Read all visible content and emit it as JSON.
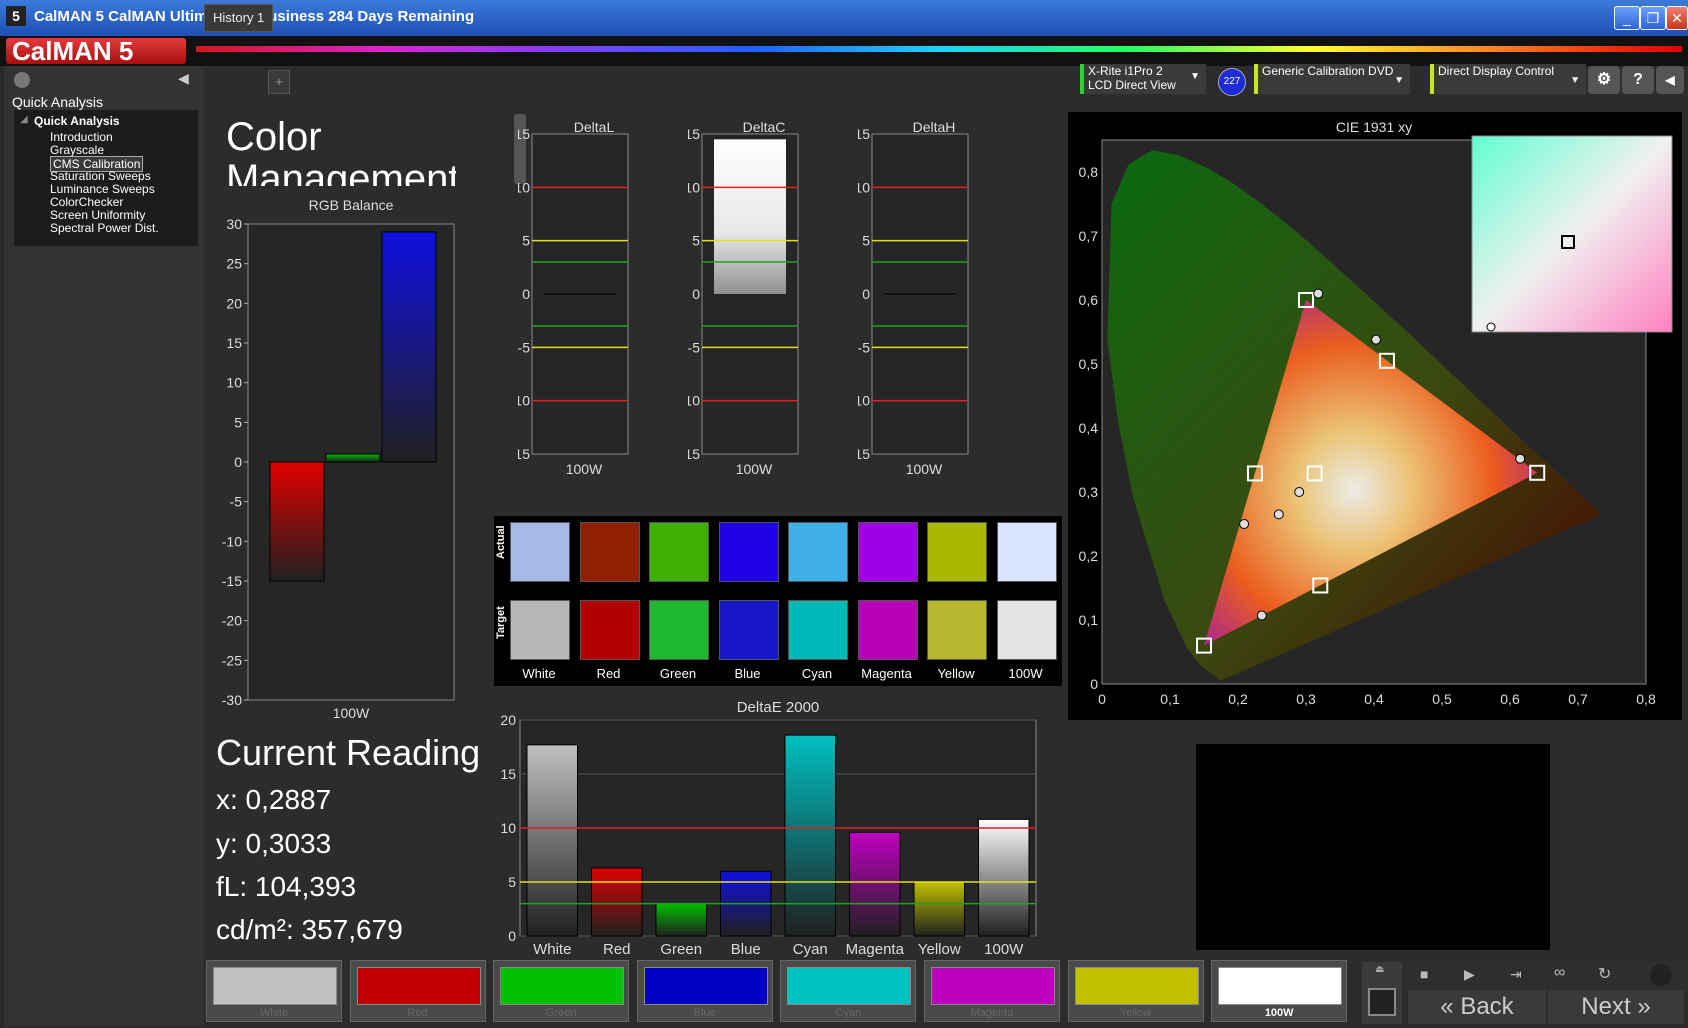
{
  "window": {
    "title": "CalMAN 5 CalMAN Ultimate for Business 284 Days Remaining",
    "app_icon": "5",
    "minimize": "_",
    "restore": "❐",
    "close": "✕"
  },
  "logo": "CalMAN 5",
  "sidebar": {
    "section_label": "Quick Analysis",
    "tree_root": "Quick Analysis",
    "items": [
      "Introduction",
      "Grayscale",
      "CMS Calibration",
      "Saturation Sweeps",
      "Luminance Sweeps",
      "ColorChecker",
      "Screen Uniformity",
      "Spectral Power Dist."
    ],
    "selected_index": 2
  },
  "tabs": {
    "active": "History 1",
    "add": "+"
  },
  "devices": {
    "meter_line1": "X-Rite i1Pro 2",
    "meter_line2": "LCD Direct View",
    "meter_badge": "227",
    "source": "Generic Calibration DVD",
    "display": "Direct Display Control",
    "settings_icon": "⚙",
    "help_icon": "?",
    "collapse_icon": "◀"
  },
  "page": {
    "title_line1": "Color",
    "title_line2": "Management"
  },
  "reading": {
    "heading": "Current Reading",
    "x": "x: 0,2887",
    "y": "y: 0,3033",
    "fl": "fL: 104,393",
    "cdm2": "cd/m²: 357,679"
  },
  "colors": {
    "red": "#e00000",
    "green": "#00c000",
    "blue": "#1010e0",
    "cyan": "#00c0c0",
    "magenta": "#c000c0",
    "yellow": "#c0c000",
    "white": "#ffffff",
    "gray": "#c0c0c0"
  },
  "rgb_chart": {
    "type": "bar",
    "title": "RGB Balance",
    "categories": [
      "100W"
    ],
    "series": [
      {
        "values": [
          -15
        ]
      },
      {
        "values": [
          1
        ]
      },
      {
        "values": [
          29
        ]
      }
    ],
    "ylim": [
      -30,
      30
    ],
    "yticks": [
      "30",
      "25",
      "20",
      "15",
      "10",
      "5",
      "0",
      "-5",
      "-10",
      "-15",
      "-20",
      "-25",
      "-30"
    ]
  },
  "delta_charts": [
    {
      "type": "bar",
      "title": "DeltaL",
      "categories": [
        "100W"
      ],
      "values": [
        0
      ],
      "ylim": [
        -15,
        15
      ],
      "yticks": [
        "15",
        "10",
        "5",
        "0",
        "-5",
        "-10",
        "-15"
      ]
    },
    {
      "type": "bar",
      "title": "DeltaC",
      "categories": [
        "100W"
      ],
      "values": [
        14.5
      ],
      "ylim": [
        -15,
        15
      ],
      "yticks": [
        "15",
        "10",
        "5",
        "0",
        "-5",
        "-10",
        "-15"
      ]
    },
    {
      "type": "bar",
      "title": "DeltaH",
      "categories": [
        "100W"
      ],
      "values": [
        0
      ],
      "ylim": [
        -15,
        15
      ],
      "yticks": [
        "15",
        "10",
        "5",
        "0",
        "-5",
        "-10",
        "-15"
      ]
    }
  ],
  "swatch_grid": {
    "row_actual": "Actual",
    "row_target": "Target",
    "labels": [
      "White",
      "Red",
      "Green",
      "Blue",
      "Cyan",
      "Magenta",
      "Yellow",
      "100W"
    ],
    "actual": [
      "#a8b8e8",
      "#902000",
      "#40b000",
      "#2000e8",
      "#40b0e8",
      "#a000e8",
      "#a8b800",
      "#d8e4ff"
    ],
    "target": [
      "#b8b8b8",
      "#b00000",
      "#20b830",
      "#1818c8",
      "#00b8b8",
      "#b800b8",
      "#b8b830",
      "#e4e4e4"
    ]
  },
  "deltae_chart": {
    "type": "bar",
    "title": "DeltaE 2000",
    "categories": [
      "White",
      "Red",
      "Green",
      "Blue",
      "Cyan",
      "Magenta",
      "Yellow",
      "100W"
    ],
    "values": [
      17.7,
      6.3,
      3.0,
      6.0,
      18.6,
      9.6,
      5.0,
      10.8
    ],
    "ylim": [
      0,
      20
    ],
    "yticks": [
      "20",
      "15",
      "10",
      "5",
      "0"
    ]
  },
  "cie_chart": {
    "type": "scatter",
    "title": "CIE 1931 xy",
    "xlim": [
      0,
      0.8
    ],
    "ylim": [
      0,
      0.85
    ],
    "xticks": [
      "0",
      "0,1",
      "0,2",
      "0,3",
      "0,4",
      "0,5",
      "0,6",
      "0,7",
      "0,8"
    ],
    "yticks": [
      "0",
      "0,1",
      "0,2",
      "0,3",
      "0,4",
      "0,5",
      "0,6",
      "0,7",
      "0,8"
    ],
    "targets": [
      [
        0.64,
        0.33
      ],
      [
        0.3,
        0.6
      ],
      [
        0.15,
        0.06
      ],
      [
        0.225,
        0.329
      ],
      [
        0.321,
        0.154
      ],
      [
        0.419,
        0.505
      ],
      [
        0.3127,
        0.329
      ]
    ],
    "measured": [
      [
        0.615,
        0.352
      ],
      [
        0.318,
        0.61
      ],
      [
        0.235,
        0.107
      ],
      [
        0.209,
        0.25
      ],
      [
        0.26,
        0.265
      ],
      [
        0.29,
        0.3
      ],
      [
        0.403,
        0.538
      ]
    ]
  },
  "bottom_swatches": {
    "labels": [
      "White",
      "Red",
      "Green",
      "Blue",
      "Cyan",
      "Magenta",
      "Yellow",
      "100W"
    ],
    "colors": [
      "#c0c0c0",
      "#c00000",
      "#00c000",
      "#0000c0",
      "#00c0c0",
      "#c000c0",
      "#c0c000",
      "#ffffff"
    ],
    "selected_index": 7
  },
  "nav": {
    "back": "Back",
    "next": "Next"
  }
}
